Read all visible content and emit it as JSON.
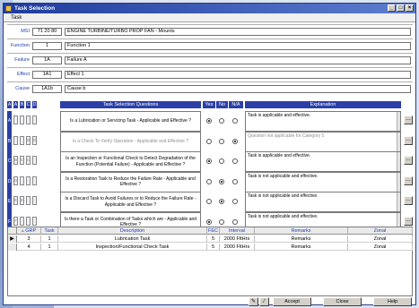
{
  "window": {
    "title": "Task Selection"
  },
  "menu": {
    "task": "Task"
  },
  "header": {
    "msi": {
      "label": "MSI",
      "code": "71 20 80",
      "text": "ENGINE TURBINE/TURBO PROP FAN - Mounts"
    },
    "function": {
      "label": "Function",
      "code": "1",
      "text": "Function 1"
    },
    "failure": {
      "label": "Failure",
      "code": "1A",
      "text": "Failure A"
    },
    "effect": {
      "label": "Effect",
      "code": "1A1",
      "text": "Effect 1"
    },
    "cause": {
      "label": "Cause",
      "code": "1A1b",
      "text": "Cause b"
    }
  },
  "questions_header": {
    "letters": [
      "A",
      "B",
      "C",
      "D"
    ],
    "title": "Task Selection Questions",
    "yes": "Yes",
    "no": "No",
    "na": "N/A",
    "explanation": "Explanation"
  },
  "questions": [
    {
      "cat": "A",
      "marks": [
        "",
        "",
        "",
        ""
      ],
      "text": "Is a Lubrication or Servicing Task - Applicable and Effective ?",
      "answer": "yes",
      "explanation": "Task is applicable and effective.",
      "dim": false
    },
    {
      "cat": "B",
      "marks": [
        "",
        "",
        "B",
        "D"
      ],
      "text": "Is a Check To Verify Operation - Applicable and Effective ?",
      "answer": "na",
      "explanation": "Question not applicable for Category 5",
      "dim": true
    },
    {
      "cat": "C",
      "marks": [
        "B",
        "C",
        "C",
        ""
      ],
      "text": "Is an Inspection or Functional Check to Detect Degradation of the Function (Potential Failure) - Applicable and Effective ?",
      "answer": "yes",
      "explanation": "Task is applicable and effective.",
      "dim": false
    },
    {
      "cat": "D",
      "marks": [
        "D",
        "",
        "",
        ""
      ],
      "text": "Is a Restoration Task to Reduce the Failure Rate - Applicable and Effective ?",
      "answer": "no",
      "explanation": "Task is not applicable and effective.",
      "dim": false
    },
    {
      "cat": "E",
      "marks": [
        "E",
        "E",
        "",
        ""
      ],
      "text": "Is a Discard Task to Avoid Failures or to Reduce the Failure Rate - Applicable and Effective ?",
      "answer": "no",
      "explanation": "Task is not applicable and effective.",
      "dim": false
    },
    {
      "cat": "F",
      "marks": [
        "F",
        "",
        "",
        ""
      ],
      "text": "Is there a Task or Combination of Tasks which are - Applicable and Effective ?",
      "answer": "yes",
      "explanation": "Task is not applicable and effective.",
      "dim": false
    }
  ],
  "tasks_table": {
    "columns": [
      "GRP",
      "Task",
      "Description",
      "FEC",
      "Interval",
      "Remarks",
      "Zonal"
    ],
    "rows": [
      {
        "grp": "3",
        "task": "1",
        "description": "Lubrication Task",
        "fec": "5",
        "interval": "2000 FltHrs",
        "remarks": "Remarks",
        "zonal": "Zonal"
      },
      {
        "grp": "4",
        "task": "1",
        "description": "Inspection/Functional Check Task",
        "fec": "5",
        "interval": "2000 FltHrs",
        "remarks": "Remarks",
        "zonal": "Zonal"
      }
    ]
  },
  "footer": {
    "accept": "Accept",
    "close": "Close",
    "help": "Help"
  },
  "icons": {
    "note": "note-pad-icon",
    "edit": "pencil-icon"
  },
  "colors": {
    "header_blue": "#2b3fa6",
    "title_gradient_start": "#1e3b9c",
    "label_blue": "#2040b0"
  }
}
